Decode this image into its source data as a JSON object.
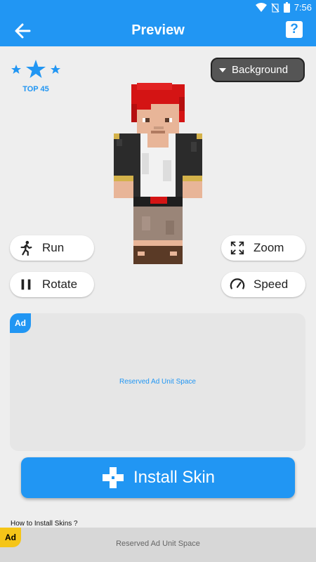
{
  "status_bar": {
    "time": "7:56"
  },
  "app_bar": {
    "title": "Preview",
    "help_label": "?"
  },
  "rating": {
    "stars": 3,
    "label": "TOP 45",
    "color": "#2196f3"
  },
  "background_button": {
    "label": "Background"
  },
  "controls": {
    "run": "Run",
    "rotate": "Rotate",
    "zoom": "Zoom",
    "speed": "Speed"
  },
  "ad_panel": {
    "badge": "Ad",
    "text": "Reserved Ad Unit Space"
  },
  "install_button": {
    "label": "Install Skin"
  },
  "how_to": {
    "text": "How to Install Skins ?"
  },
  "bottom_ad": {
    "badge": "Ad",
    "text": "Reserved Ad Unit Space"
  },
  "colors": {
    "primary": "#2196f3",
    "badge_yellow": "#f5c518"
  }
}
